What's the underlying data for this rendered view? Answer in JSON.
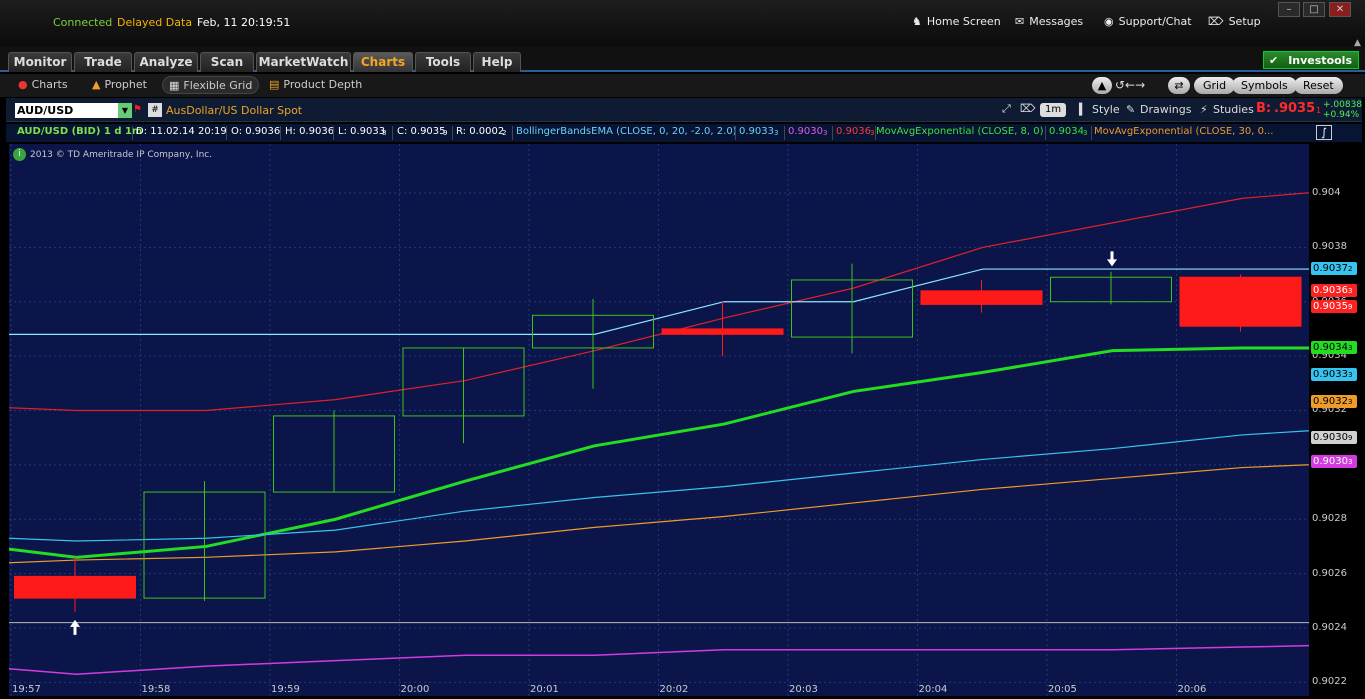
{
  "topbar": {
    "connected": "Connected",
    "delayed": "Delayed Data",
    "datetime": "Feb, 11  20:19:51",
    "home": "Home Screen",
    "messages": "Messages",
    "support": "Support/Chat",
    "setup": "Setup"
  },
  "tabs": [
    "Monitor",
    "Trade",
    "Analyze",
    "Scan",
    "MarketWatch",
    "Charts",
    "Tools",
    "Help"
  ],
  "investools": "Investools",
  "subnav": {
    "charts": "Charts",
    "prophet": "Prophet",
    "flexible_grid": "Flexible Grid",
    "product_depth": "Product Depth",
    "grid": "Grid",
    "symbols": "Symbols",
    "reset": "Reset"
  },
  "chart": {
    "symbol": "AUD/USD",
    "description": "AusDollar/US Dollar Spot",
    "timeframe": "1m",
    "style": "Style",
    "drawings": "Drawings",
    "studies": "Studies",
    "bid_label": "B:",
    "bid_value": ".9035",
    "bid_sub": "1",
    "change": "+.00838",
    "change_pct": "+0.94%",
    "info": {
      "title": "AUD/USD (BID) 1 d 1m",
      "date": "D: 11.02.14 20:19",
      "open": "O: 0.9036",
      "high": "H: 0.9036",
      "low": "L: 0.9033",
      "low_sub": "8",
      "close": "C: 0.9035",
      "close_sub": "9",
      "range": "R: 0.0002",
      "range_sub": "2",
      "study1": "BollingerBandsEMA (CLOSE, 0, 20, -2.0, 2.0)",
      "bb_lower": "0.9033",
      "bb_lower_sub": "3",
      "bb_mid": "0.9030",
      "bb_mid_sub": "3",
      "bb_upper": "0.9036",
      "bb_upper_sub": "3",
      "study2": "MovAvgExponential (CLOSE, 8, 0)",
      "ema8": "0.9034",
      "ema8_sub": "3",
      "study3": "MovAvgExponential (CLOSE, 30, 0..."
    },
    "copyright": "2013 © TD Ameritrade IP Company, Inc."
  },
  "colors": {
    "bg": "#0b154a",
    "up": "#3ec21d",
    "down": "#ff1a1a",
    "ema8": "#22dd22",
    "bb_upper": "#e0202a",
    "bb_lower": "#37c3ef",
    "bb_mid": "#d23be0",
    "ema30": "#ef9b2b",
    "close_line": "#8fe4ff"
  },
  "chart_data": {
    "type": "candlestick",
    "x": [
      "19:57",
      "19:58",
      "19:59",
      "20:00",
      "20:01",
      "20:02",
      "20:03",
      "20:04",
      "20:05",
      "20:06"
    ],
    "yticks": [
      "0.9022",
      "0.9024",
      "0.9026",
      "0.9028",
      "0.903",
      "0.9032",
      "0.9034",
      "0.9036",
      "0.9038",
      "0.904"
    ],
    "ylim": [
      0.90215,
      0.90418
    ],
    "candles": [
      {
        "o": 0.90259,
        "h": 0.90266,
        "l": 0.90246,
        "c": 0.90251
      },
      {
        "o": 0.90251,
        "h": 0.90294,
        "l": 0.9025,
        "c": 0.9029
      },
      {
        "o": 0.9029,
        "h": 0.9032,
        "l": 0.9029,
        "c": 0.90318
      },
      {
        "o": 0.90318,
        "h": 0.90343,
        "l": 0.90308,
        "c": 0.90343
      },
      {
        "o": 0.90343,
        "h": 0.90361,
        "l": 0.90328,
        "c": 0.90355
      },
      {
        "o": 0.9035,
        "h": 0.9036,
        "l": 0.9034,
        "c": 0.90348
      },
      {
        "o": 0.90347,
        "h": 0.90374,
        "l": 0.90341,
        "c": 0.90368
      },
      {
        "o": 0.90364,
        "h": 0.90368,
        "l": 0.90356,
        "c": 0.90359
      },
      {
        "o": 0.9036,
        "h": 0.90371,
        "l": 0.90359,
        "c": 0.90369
      },
      {
        "o": 0.90369,
        "h": 0.9037,
        "l": 0.90349,
        "c": 0.90351
      }
    ],
    "series": [
      {
        "values": [
          0.90321,
          0.9032,
          0.9032,
          0.90324,
          0.90331,
          0.90342,
          0.90354,
          0.90365,
          0.9038,
          0.90389,
          0.90398,
          0.90402
        ]
      },
      {
        "values": [
          0.90269,
          0.90266,
          0.9027,
          0.9028,
          0.90294,
          0.90307,
          0.90315,
          0.90327,
          0.90334,
          0.90342,
          0.90343,
          0.90343
        ]
      },
      {
        "values": [
          0.90273,
          0.90272,
          0.90273,
          0.90276,
          0.90283,
          0.90288,
          0.90292,
          0.90297,
          0.90302,
          0.90306,
          0.90311,
          0.90314
        ]
      },
      {
        "values": [
          0.90264,
          0.90265,
          0.90266,
          0.90268,
          0.90272,
          0.90277,
          0.90281,
          0.90286,
          0.90291,
          0.90295,
          0.90299,
          0.90301
        ]
      },
      {
        "values": [
          0.90225,
          0.90223,
          0.90226,
          0.90228,
          0.9023,
          0.9023,
          0.90232,
          0.90232,
          0.90232,
          0.90232,
          0.90233,
          0.90234
        ]
      },
      {
        "values": [
          0.90348,
          0.90348,
          0.90348,
          0.90348,
          0.90348,
          0.90348,
          0.9036,
          0.9036,
          0.90372,
          0.90372,
          0.90372,
          0.90372
        ]
      }
    ],
    "price_labels": [
      {
        "text": "0.9037",
        "sub": "2",
        "value": 0.90372,
        "color": "#37c3ef"
      },
      {
        "text": "0.9036",
        "sub": "3",
        "value": 0.90364,
        "color": "#ff2020"
      },
      {
        "text": "0.9035",
        "sub": "9",
        "value": 0.90358,
        "color": "#ff2020"
      },
      {
        "text": "0.9034",
        "sub": "3",
        "value": 0.90343,
        "color": "#22dd22"
      },
      {
        "text": "0.9033",
        "sub": "3",
        "value": 0.90333,
        "color": "#37c3ef"
      },
      {
        "text": "0.9032",
        "sub": "3",
        "value": 0.90323,
        "color": "#ef9b2b"
      },
      {
        "text": "0.9030",
        "sub": "9",
        "value": 0.9031,
        "color": "#d0d0d0"
      },
      {
        "text": "0.9030",
        "sub": "3",
        "value": 0.90301,
        "color": "#d23be0"
      }
    ]
  }
}
